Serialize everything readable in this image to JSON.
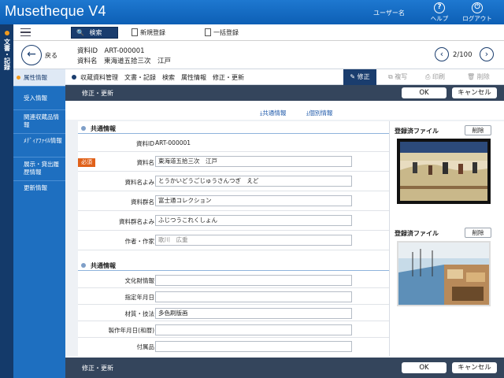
{
  "header": {
    "app_title": "Musetheque V4",
    "user": "ユーザー名",
    "help_label": "ヘルプ",
    "logout_label": "ログアウト",
    "help_icon": "question-icon",
    "logout_icon": "power-icon"
  },
  "left_strip": {
    "label": "文書・記録"
  },
  "toolbar": {
    "search_label": "検索",
    "new_label": "新規登録",
    "bulk_label": "一括登録"
  },
  "record": {
    "back_label": "戻る",
    "id_line": "資料ID　ART-000001",
    "name_line": "資料名　東海道五拾三次　江戸",
    "pager": "2/100"
  },
  "sidebar": {
    "items": [
      {
        "label": "属性情報",
        "active": true
      },
      {
        "label": "受入情報"
      },
      {
        "label": "関連収蔵品情報"
      },
      {
        "label": "ﾒﾃﾞｨｱﾌｧｲﾙ情報"
      },
      {
        "label": "展示・貸出履歴情報"
      },
      {
        "label": "更新情報"
      }
    ]
  },
  "breadcrumb": "収蔵資料管理　文書・記録　検索　属性情報　修正・更新",
  "actions": {
    "edit": "修正",
    "copy": "複写",
    "print": "印刷",
    "delete": "削除"
  },
  "section_bar": {
    "title": "修正・更新",
    "ok": "OK",
    "cancel": "キャンセル"
  },
  "links": {
    "common": "共通情報",
    "individual": "個別情報"
  },
  "form": {
    "group1_title": "共通情報",
    "fields1": [
      {
        "label": "資料ID",
        "value": "ART-000001",
        "type": "text"
      },
      {
        "label": "資料名",
        "value": "東海道五拾三次　江戸",
        "type": "input",
        "required": "必須"
      },
      {
        "label": "資料名よみ",
        "value": "とうかいどうごじゅうさんつぎ　えど",
        "type": "input"
      },
      {
        "label": "資料群名",
        "value": "富士通コレクション",
        "type": "input"
      },
      {
        "label": "資料群名よみ",
        "value": "ふじつうこれくしょん",
        "type": "input"
      },
      {
        "label": "作者・作家",
        "value": "歌川　広重",
        "type": "input-placeholder"
      }
    ],
    "group2_title": "共通情報",
    "fields2": [
      {
        "label": "文化財情報",
        "value": ""
      },
      {
        "label": "指定年月日",
        "value": ""
      },
      {
        "label": "材質・技法",
        "value": "多色刷版画"
      },
      {
        "label": "製作年月日(和暦)",
        "value": ""
      },
      {
        "label": "付属品",
        "value": ""
      }
    ]
  },
  "files": {
    "title": "登録済ファイル",
    "delete": "削除"
  },
  "footer_bar": {
    "title": "修正・更新",
    "ok": "OK",
    "cancel": "キャンセル"
  }
}
